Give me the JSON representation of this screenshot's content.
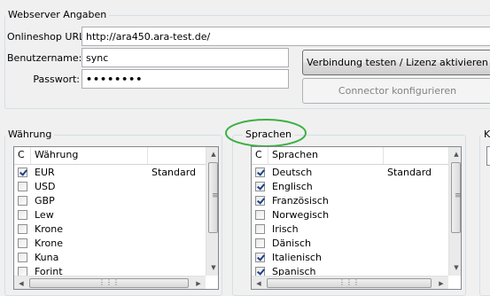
{
  "webserver": {
    "group_title": "Webserver Angaben",
    "url_label": "Onlineshop URL:",
    "url_value": "http://ara450.ara-test.de/",
    "user_label": "Benutzername:",
    "user_value": "sync",
    "password_label": "Passwort:",
    "password_value": "••••••••",
    "test_button": "Verbindung testen / Lizenz aktivieren",
    "configure_button": "Connector konfigurieren"
  },
  "currency": {
    "group_title": "Währung",
    "col_c": "C",
    "col_name": "Währung",
    "rows": [
      {
        "name": "EUR",
        "checked": true,
        "note": "Standard"
      },
      {
        "name": "USD",
        "checked": false,
        "note": ""
      },
      {
        "name": "GBP",
        "checked": false,
        "note": ""
      },
      {
        "name": "Lew",
        "checked": false,
        "note": ""
      },
      {
        "name": "Krone",
        "checked": false,
        "note": ""
      },
      {
        "name": "Krone",
        "checked": false,
        "note": ""
      },
      {
        "name": "Kuna",
        "checked": false,
        "note": ""
      },
      {
        "name": "Forint",
        "checked": false,
        "note": ""
      }
    ]
  },
  "languages": {
    "group_title": "Sprachen",
    "col_c": "C",
    "col_name": "Sprachen",
    "rows": [
      {
        "name": "Deutsch",
        "checked": true,
        "note": "Standard"
      },
      {
        "name": "Englisch",
        "checked": true,
        "note": ""
      },
      {
        "name": "Französisch",
        "checked": true,
        "note": ""
      },
      {
        "name": "Norwegisch",
        "checked": false,
        "note": ""
      },
      {
        "name": "Irisch",
        "checked": false,
        "note": ""
      },
      {
        "name": "Dänisch",
        "checked": false,
        "note": ""
      },
      {
        "name": "Italienisch",
        "checked": true,
        "note": ""
      },
      {
        "name": "Spanisch",
        "checked": true,
        "note": ""
      }
    ]
  },
  "third_group": {
    "group_title": "K"
  },
  "colors": {
    "highlight_circle": "#3cb043"
  }
}
